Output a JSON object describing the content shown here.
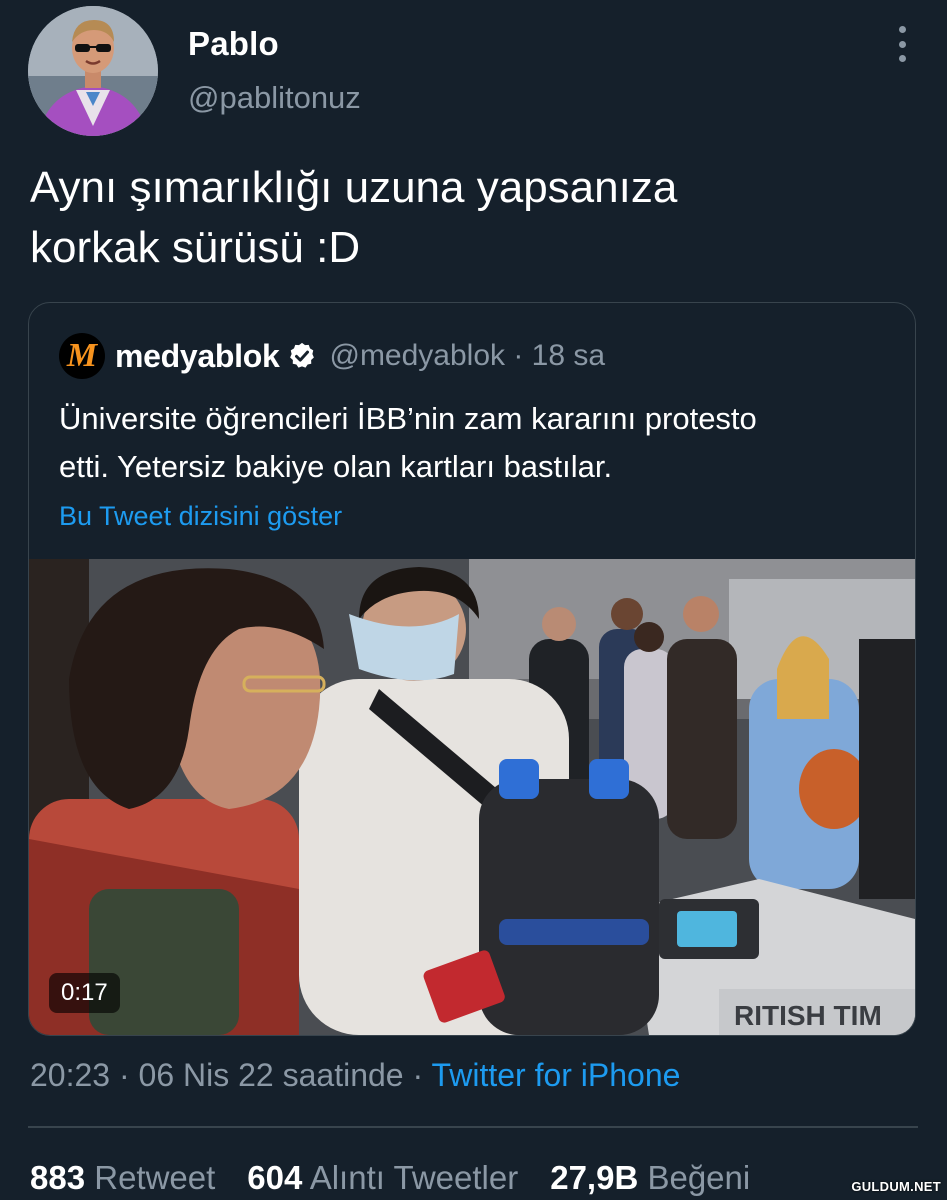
{
  "author": {
    "display_name": "Pablo",
    "handle": "@pablitonuz"
  },
  "tweet": {
    "text": "Aynı şımarıklığı uzuna yapsanıza\nkorkak sürüsü :D"
  },
  "quote": {
    "avatar_letter": "M",
    "name": "medyablok",
    "meta": "@medyablok · 18 sa",
    "text": "Üniversite öğrencileri İBB’nin zam kararını protesto\netti. Yetersiz bakiye olan kartları bastılar.",
    "thread_link": "Bu Tweet dizisini göster",
    "video_duration": "0:17",
    "video_sign_text": "RITISH TIM"
  },
  "timestamp": {
    "time_date": "20:23 · 06 Nis 22 saatinde · ",
    "source": "Twitter for iPhone"
  },
  "stats": [
    {
      "num": "883",
      "label": "Retweet"
    },
    {
      "num": "604",
      "label": "Alıntı Tweetler"
    },
    {
      "num": "27,9B",
      "label": "Beğeni"
    }
  ],
  "watermark": "GULDUM.NET",
  "colors": {
    "background": "#15202b",
    "text_primary": "#ffffff",
    "text_secondary": "#8b98a5",
    "link": "#1d9bf0",
    "border": "#38444d",
    "quote_avatar_accent": "#f7931e"
  },
  "icons": {
    "more": "more-vertical-icon",
    "verified": "verified-badge-icon"
  }
}
